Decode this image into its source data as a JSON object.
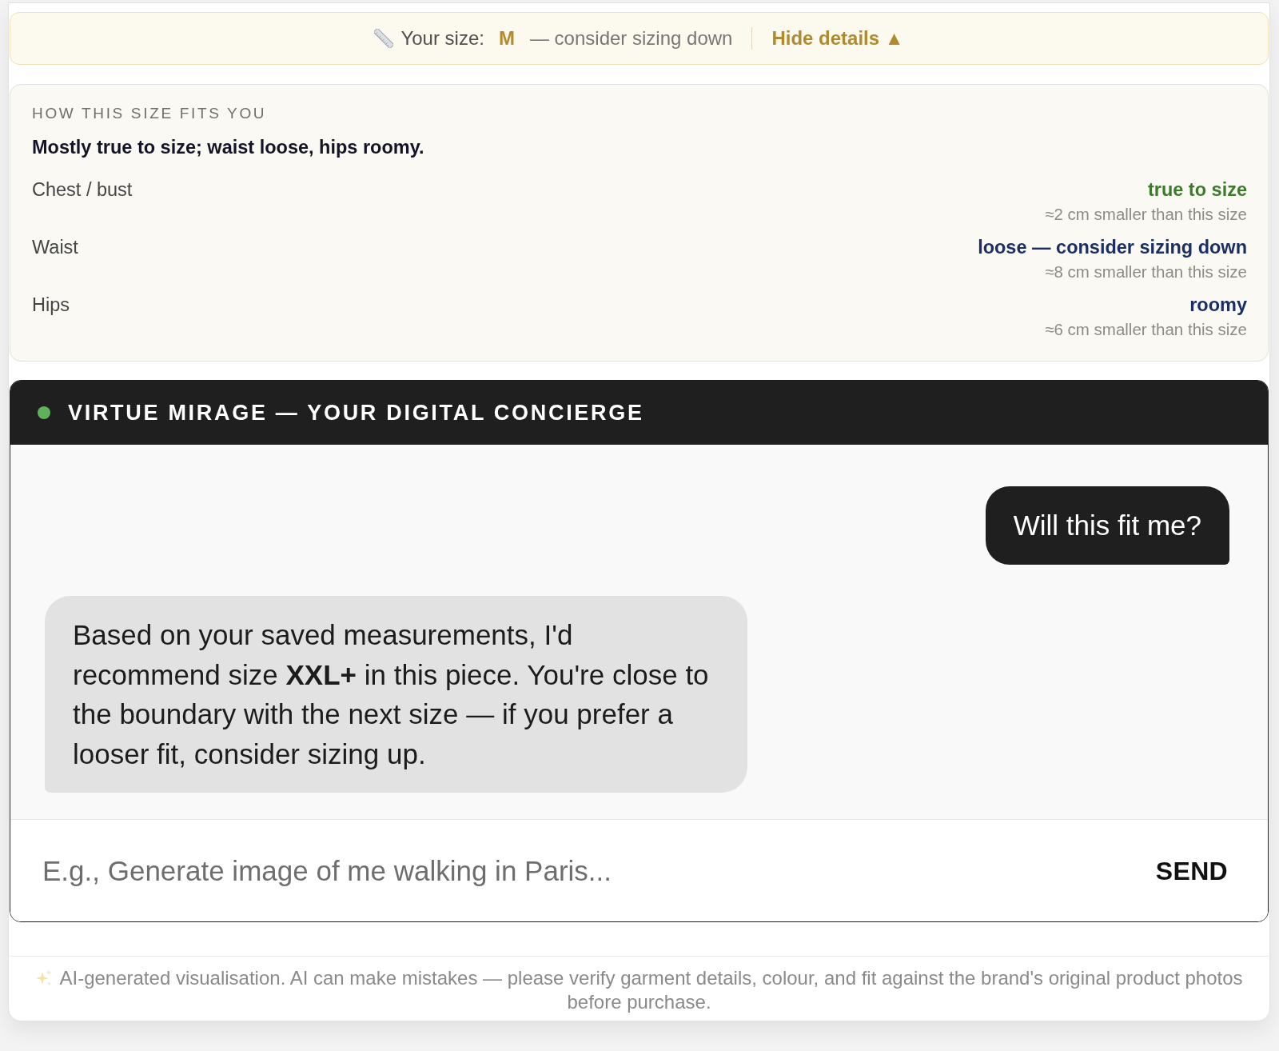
{
  "size_banner": {
    "label": "Your size:",
    "size": "M",
    "advice": "— consider sizing down",
    "toggle": "Hide details ▲"
  },
  "fit_details": {
    "heading": "HOW THIS SIZE FITS YOU",
    "summary": "Mostly true to size; waist loose, hips roomy.",
    "rows": [
      {
        "label": "Chest / bust",
        "verdict": "true to size",
        "color": "#3d7a2c",
        "note": "≈2 cm smaller than this size"
      },
      {
        "label": "Waist",
        "verdict": "loose — consider sizing down",
        "color": "#1c2f62",
        "note": "≈8 cm smaller than this size"
      },
      {
        "label": "Hips",
        "verdict": "roomy",
        "color": "#1c2f62",
        "note": "≈6 cm smaller than this size"
      }
    ]
  },
  "chat": {
    "title": "VIRTUE MIRAGE — YOUR DIGITAL CONCIERGE",
    "online": true,
    "messages": [
      {
        "kind": "user",
        "text": "Will this fit me?"
      },
      {
        "kind": "assistant",
        "text": "Based on your saved measurements, I'd recommend size **XXL+** in this piece. You're close to the boundary with the next size — if you prefer a looser fit, consider sizing up."
      }
    ],
    "input": {
      "placeholder": "E.g., Generate image of me walking in Paris..."
    },
    "send_button": "SEND"
  },
  "disclaimer": "AI-generated visualisation. AI can make mistakes — please verify garment details, colour, and fit against the brand's original product photos before purchase."
}
